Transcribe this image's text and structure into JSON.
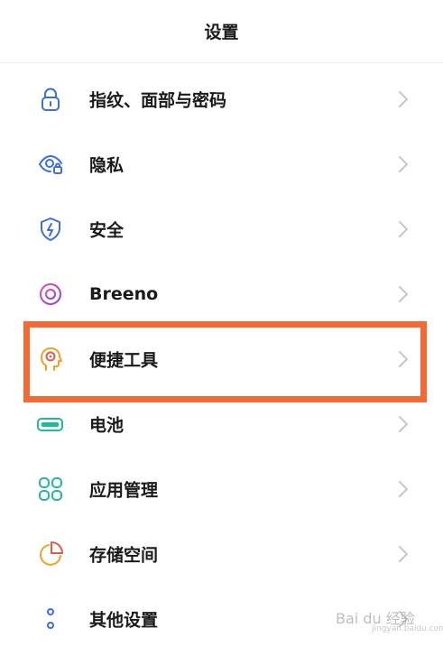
{
  "header": {
    "title": "设置"
  },
  "settings": {
    "items": [
      {
        "label": "指纹、面部与密码",
        "icon": "lock-icon",
        "color": "#3d6fe0"
      },
      {
        "label": "隐私",
        "icon": "privacy-eye-icon",
        "color": "#3d6fe0"
      },
      {
        "label": "安全",
        "icon": "shield-icon",
        "color": "#3d6fe0"
      },
      {
        "label": "Breeno",
        "icon": "breeno-ring-icon",
        "color": "#c04fc9"
      },
      {
        "label": "便捷工具",
        "icon": "head-target-icon",
        "color": "#f0a21d"
      },
      {
        "label": "电池",
        "icon": "battery-icon",
        "color": "#20b99c"
      },
      {
        "label": "应用管理",
        "icon": "apps-grid-icon",
        "color": "#20b99c"
      },
      {
        "label": "存储空间",
        "icon": "storage-pie-icon",
        "color": "#f0a21d"
      },
      {
        "label": "其他设置",
        "icon": "more-dots-icon",
        "color": "#3d6fe0"
      }
    ]
  },
  "highlight": {
    "color": "#f26a35",
    "target": "便捷工具"
  },
  "watermark": {
    "text": "Bai du 经验",
    "sub": "jingyan.baidu.com"
  }
}
